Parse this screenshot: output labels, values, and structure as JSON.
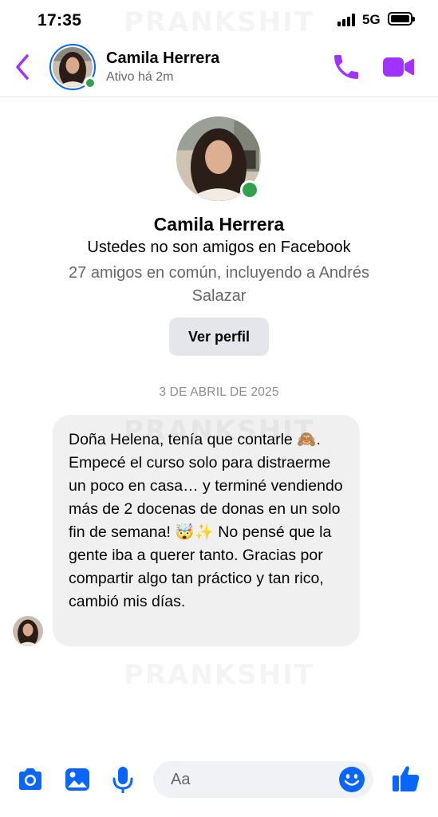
{
  "status_bar": {
    "time": "17:35",
    "network": "5G",
    "signal_icon": "cellular-signal-icon",
    "battery_icon": "battery-icon"
  },
  "header": {
    "back_icon": "chevron-left-icon",
    "name": "Camila Herrera",
    "subtitle": "Ativo há 2m",
    "call_icon": "phone-icon",
    "video_icon": "video-camera-icon"
  },
  "profile": {
    "name": "Camila Herrera",
    "relationship": "Ustedes no son amigos en Facebook",
    "mutual_friends": "27 amigos en común, incluyendo a Andrés Salazar",
    "view_profile_label": "Ver perfil"
  },
  "conversation": {
    "date_separator": "3 DE ABRIL DE 2025",
    "messages": [
      {
        "sender": "Camila Herrera",
        "text": "Doña Helena, tenía que contarle 🙈. Empecé el curso solo para distraerme un poco en casa… y terminé vendiendo más de 2 docenas de donas en un solo fin de semana! 🤯✨ No pensé que la gente iba a querer tanto. Gracias por compartir algo tan práctico y tan rico, cambió mis días."
      }
    ]
  },
  "composer": {
    "placeholder": "Aa",
    "camera_icon": "camera-icon",
    "gallery_icon": "image-gallery-icon",
    "mic_icon": "microphone-icon",
    "emoji_icon": "smiley-icon",
    "like_icon": "thumbs-up-icon"
  },
  "watermark": "PRANKSHIT",
  "colors": {
    "accent_purple": "#a033ff",
    "accent_blue": "#0866ff",
    "online_green": "#31a24c",
    "bubble_gray": "#f0f0f0",
    "secondary_text": "#65676b"
  }
}
